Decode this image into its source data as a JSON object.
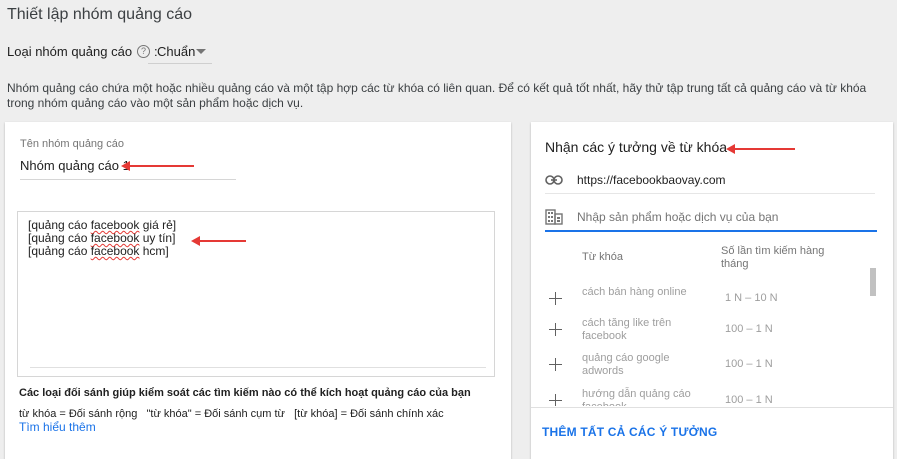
{
  "header": {
    "title": "Thiết lập nhóm quảng cáo",
    "type_label": "Loại nhóm quảng cáo",
    "help_icon": "?",
    "colon": ":",
    "type_value": "Chuẩn",
    "description": "Nhóm quảng cáo chứa một hoặc nhiều quảng cáo và một tập hợp các từ khóa có liên quan. Để có kết quả tốt nhất, hãy thử tập trung tất cả quảng cáo và từ khóa trong nhóm quảng cáo vào một sản phẩm hoặc dịch vụ."
  },
  "left": {
    "name_label": "Tên nhóm quảng cáo",
    "name_value": "Nhóm quảng cáo 1",
    "keywords": [
      "[quảng cáo facebook giá rẻ]",
      "[quảng cáo facebook uy tín]",
      "[quảng cáo facebook hcm]"
    ],
    "match_title": "Các loại đối sánh giúp kiểm soát các tìm kiếm nào có thể kích hoạt quảng cáo của bạn",
    "match_text": "từ khóa = Đối sánh rộng   \"từ khóa\" = Đối sánh cụm từ   [từ khóa] = Đối sánh chính xác",
    "learn_more": "Tìm hiểu thêm"
  },
  "right": {
    "title": "Nhận các ý tưởng về từ khóa",
    "url_value": "https://facebookbaovay.com",
    "product_placeholder": "Nhập sản phẩm hoặc dịch vụ của bạn",
    "col_keyword": "Từ khóa",
    "col_volume": "Số lần tìm kiếm hàng tháng",
    "rows": [
      {
        "keyword": "cách bán hàng online",
        "volume": "1 N – 10 N"
      },
      {
        "keyword": "cách tăng like trên facebook",
        "volume": "100 – 1 N"
      },
      {
        "keyword": "quảng cáo google adwords",
        "volume": "100 – 1 N"
      },
      {
        "keyword": "hướng dẫn quảng cáo facebook",
        "volume": "100 – 1 N"
      }
    ],
    "add_all": "THÊM TẤT CẢ CÁC Ý TƯỞNG"
  },
  "icons": {
    "help": "help-circle-icon",
    "dropdown": "caret-down-icon",
    "link": "link-icon",
    "product": "building-icon",
    "add": "plus-icon"
  },
  "colors": {
    "accent": "#1a73e8",
    "annotation_arrow": "#e53935"
  }
}
